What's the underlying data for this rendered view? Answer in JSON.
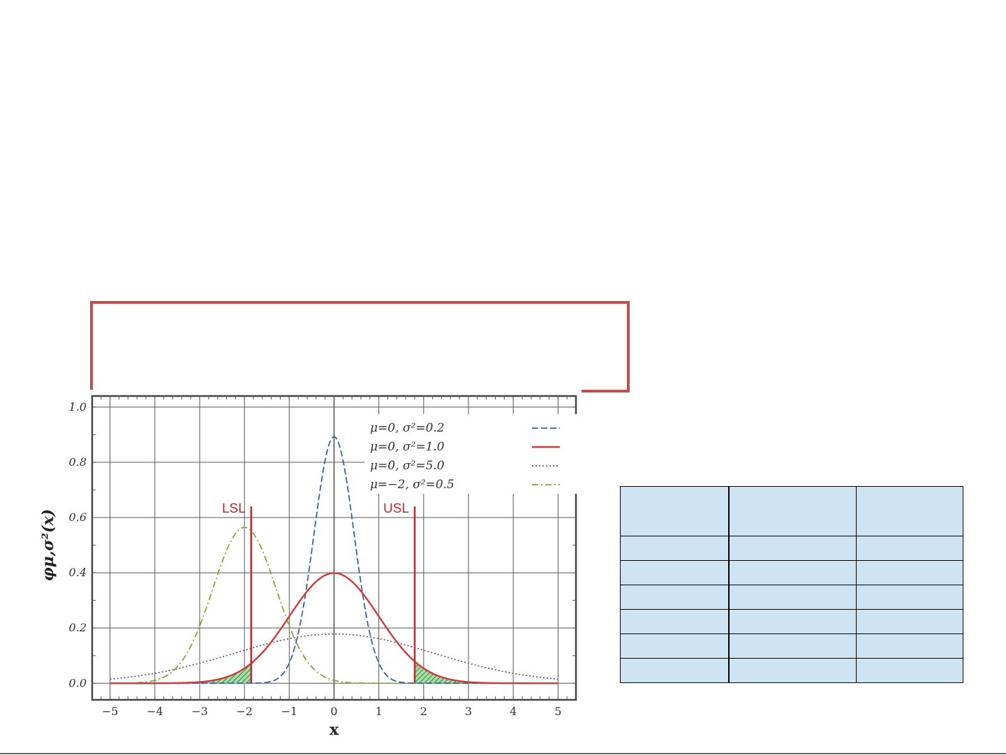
{
  "chart_data": {
    "type": "line",
    "xlabel": "x",
    "ylabel": "φμ,σ²(x)",
    "xlim": [
      -5.4,
      5.4
    ],
    "ylim": [
      -0.06,
      1.04
    ],
    "x_ticks": [
      "−5",
      "−4",
      "−3",
      "−2",
      "−1",
      "0",
      "1",
      "2",
      "3",
      "4",
      "5"
    ],
    "y_ticks": [
      "0.0",
      "0.2",
      "0.4",
      "0.6",
      "0.8",
      "1.0"
    ],
    "grid": true,
    "legend_placement": "top-right",
    "series": [
      {
        "name": "μ=0,   σ²=0.2",
        "mu": 0,
        "variance": 0.2,
        "color": "#3b5fa8",
        "style": "dashed"
      },
      {
        "name": "μ=0,   σ²=1.0",
        "mu": 0,
        "variance": 1.0,
        "color": "#d13a3a",
        "style": "solid"
      },
      {
        "name": "μ=0,   σ²=5.0",
        "mu": 0,
        "variance": 5.0,
        "color": "#7a5a6a",
        "style": "dotted"
      },
      {
        "name": "μ=−2, σ²=0.5",
        "mu": -2,
        "variance": 0.5,
        "color": "#7fa83a",
        "style": "dashdot"
      }
    ],
    "spec_limits": [
      {
        "label": "LSL",
        "x": -1.85,
        "top": 0.64,
        "color": "#c0282d"
      },
      {
        "label": "USL",
        "x": 1.8,
        "top": 0.64,
        "color": "#c0282d"
      }
    ],
    "shaded_tails": {
      "color": "#2a8a3a",
      "fill": "#a8dca8"
    }
  },
  "table": {
    "rows": 7,
    "columns": 3,
    "fill_color": "#cfe4f3"
  },
  "frame_color": "#c0504d"
}
